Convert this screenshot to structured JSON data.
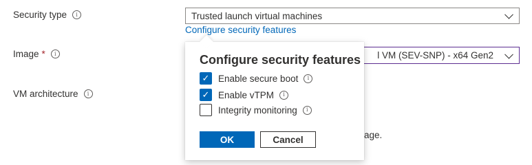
{
  "fields": {
    "security_type": {
      "label": "Security type",
      "value": "Trusted launch virtual machines"
    },
    "image": {
      "label": "Image",
      "required_mark": "*",
      "value_visible": "l VM (SEV-SNP) - x64 Gen2"
    },
    "vm_architecture": {
      "label": "VM architecture"
    }
  },
  "configure_link": "Configure security features",
  "background_text_fragment": "age.",
  "popup": {
    "title": "Configure security features",
    "options": [
      {
        "label": "Enable secure boot",
        "checked": true
      },
      {
        "label": "Enable vTPM",
        "checked": true
      },
      {
        "label": "Integrity monitoring",
        "checked": false
      }
    ],
    "ok_label": "OK",
    "cancel_label": "Cancel"
  },
  "icons": {
    "info": "info-icon",
    "check": "check-icon",
    "chevron": "chevron-down-icon"
  },
  "colors": {
    "accent": "#0067b8",
    "focus_border": "#5c2d91",
    "required": "#a4262c"
  }
}
